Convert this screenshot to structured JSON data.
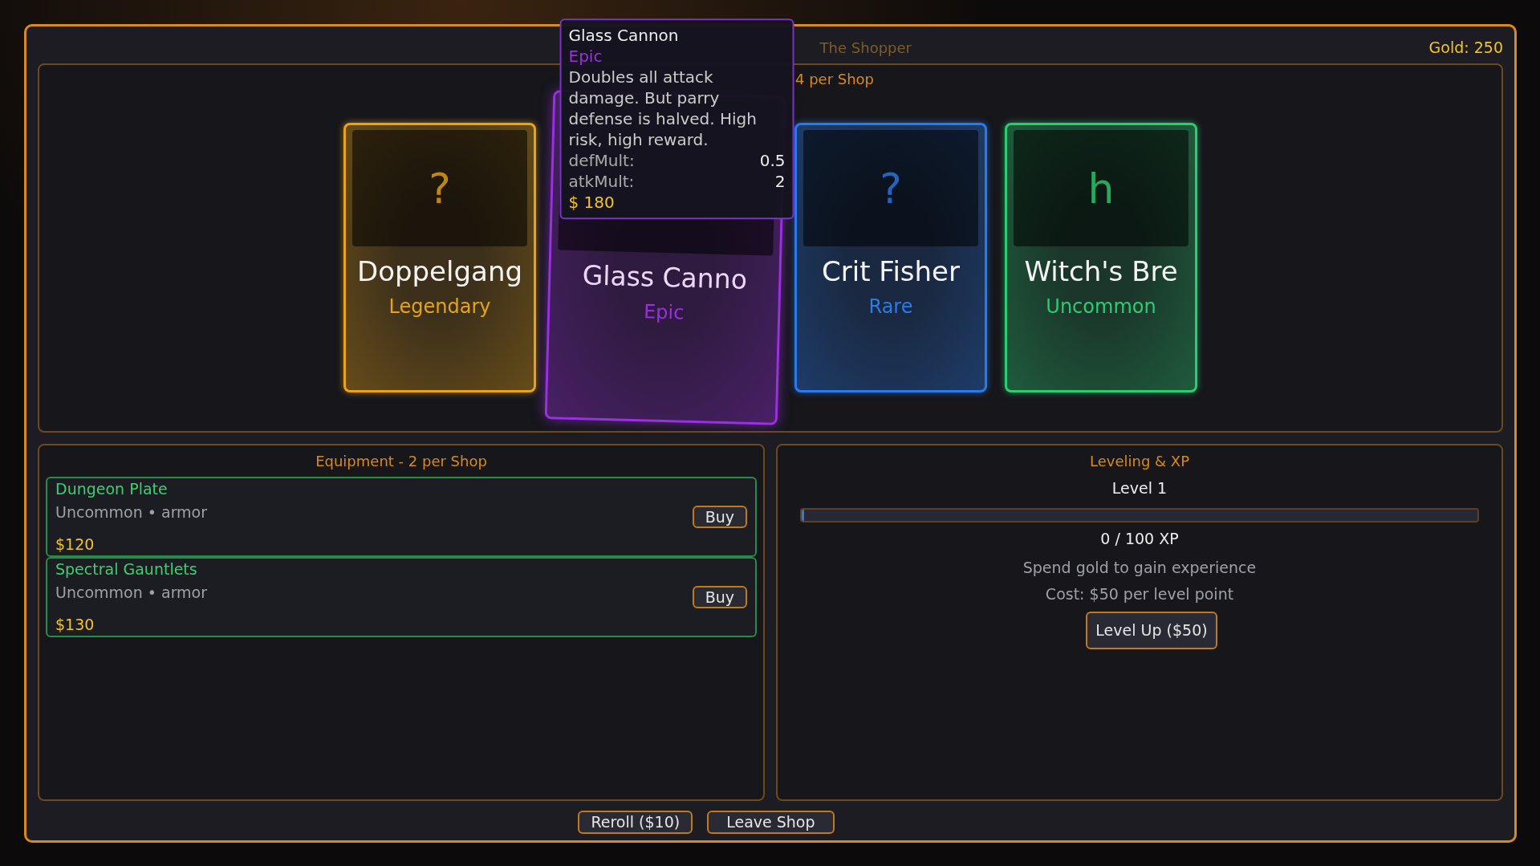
{
  "header": {
    "title": "The Shopper",
    "gold": "Gold: 250"
  },
  "relics": {
    "heading": "4 per Shop",
    "cards": [
      {
        "name": "Doppelgang",
        "rarity": "Legendary",
        "glyph": "?",
        "color": "#e8a317",
        "hovered": false
      },
      {
        "name": "Glass Canno",
        "rarity": "Epic",
        "color": "#9b30e0",
        "hovered": true
      },
      {
        "name": "Crit Fisher",
        "rarity": "Rare",
        "glyph": "?",
        "color": "#2a7ae8",
        "hovered": false
      },
      {
        "name": "Witch's Bre",
        "rarity": "Uncommon",
        "glyph": "h",
        "color": "#2ecc71",
        "hovered": false
      }
    ]
  },
  "tooltip": {
    "title": "Glass Cannon",
    "rarity": "Epic",
    "description": "Doubles all attack damage. But parry defense is halved. High risk, high reward.",
    "stats": [
      {
        "label": "defMult:",
        "value": "0.5"
      },
      {
        "label": "atkMult:",
        "value": "2"
      }
    ],
    "price": "$ 180"
  },
  "equipment": {
    "heading": "Equipment - 2 per Shop",
    "items": [
      {
        "name": "Dungeon Plate",
        "meta": "Uncommon • armor",
        "price": "$120",
        "button": "Buy"
      },
      {
        "name": "Spectral Gauntlets",
        "meta": "Uncommon • armor",
        "price": "$130",
        "button": "Buy"
      }
    ]
  },
  "leveling": {
    "heading": "Leveling & XP",
    "level_label": "Level 1",
    "xp": {
      "level": 0.004
    },
    "xp_text": "0 / 100 XP",
    "hint": "Spend gold to gain experience",
    "cost": "Cost: $50 per level point",
    "button": "Level Up ($50)"
  },
  "footer_buttons": [
    "Reroll ($10)",
    "Leave Shop"
  ]
}
